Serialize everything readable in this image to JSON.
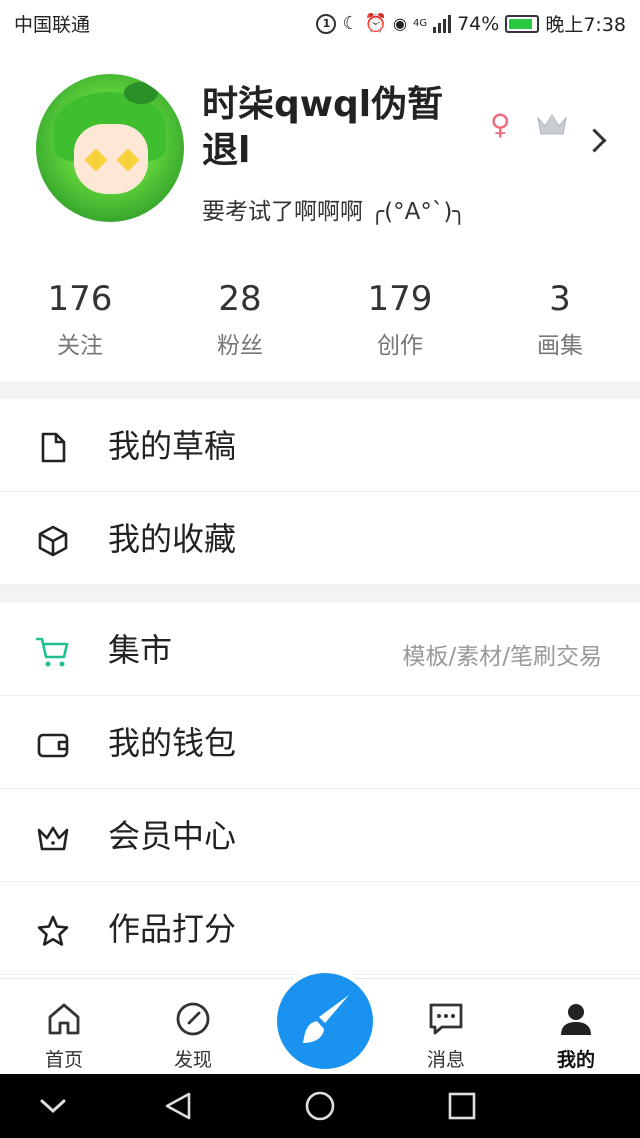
{
  "status_bar": {
    "carrier": "中国联通",
    "battery": "74%",
    "time": "晚上7:38",
    "network": "4G"
  },
  "profile": {
    "username": "时柒qwql伪暂退l",
    "bio": "要考试了啊啊啊 ╭(°A°`)╮",
    "gender_icon": "female-icon",
    "badge_icon": "crown-icon"
  },
  "stats": [
    {
      "value": "176",
      "label": "关注"
    },
    {
      "value": "28",
      "label": "粉丝"
    },
    {
      "value": "179",
      "label": "创作"
    },
    {
      "value": "3",
      "label": "画集"
    }
  ],
  "menu_group_1": [
    {
      "label": "我的草稿",
      "icon": "document-icon"
    },
    {
      "label": "我的收藏",
      "icon": "box-icon"
    }
  ],
  "menu_group_2": [
    {
      "label": "集市",
      "icon": "cart-icon",
      "hint": "模板/素材/笔刷交易"
    },
    {
      "label": "我的钱包",
      "icon": "wallet-icon"
    },
    {
      "label": "会员中心",
      "icon": "crown-icon"
    },
    {
      "label": "作品打分",
      "icon": "star-icon"
    }
  ],
  "tabbar": [
    {
      "label": "首页",
      "icon": "home-icon"
    },
    {
      "label": "发现",
      "icon": "compass-icon"
    },
    {
      "label": "",
      "icon": "brush-icon"
    },
    {
      "label": "消息",
      "icon": "message-icon"
    },
    {
      "label": "我的",
      "icon": "user-icon"
    }
  ],
  "colors": {
    "accent": "#1a93f0",
    "cart": "#1fbf8f",
    "female": "#ef6a7a"
  }
}
